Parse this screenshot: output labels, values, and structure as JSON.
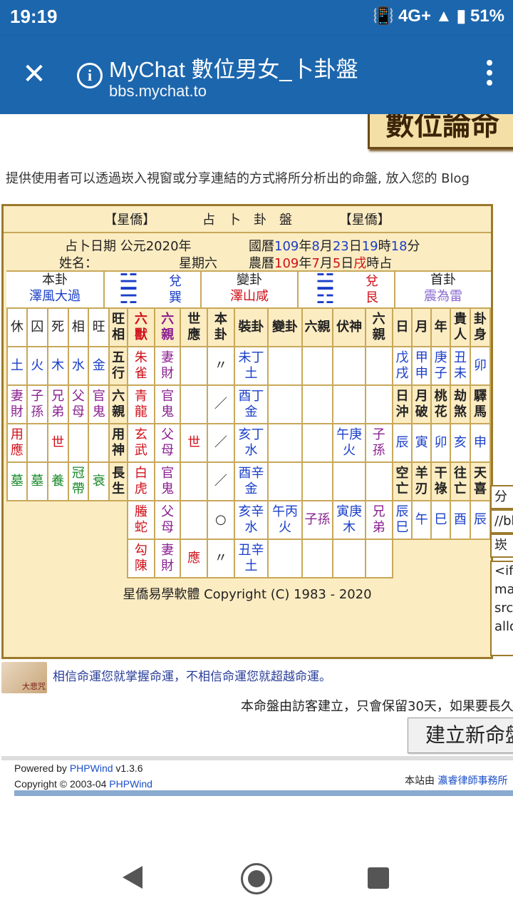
{
  "status": {
    "time": "19:19",
    "network": "4G+",
    "battery": "51%"
  },
  "appbar": {
    "title": "MyChat 數位男女_卜卦盤",
    "url": "bbs.mychat.to"
  },
  "banner": "數位論命",
  "intro": "提供使用者可以透過崁入視窗或分享連結的方式將所分析出的命盤, 放入您的 Blog",
  "board": {
    "title_left": "【星僑】",
    "title_mid": "占　卜　卦　盤",
    "title_right": "【星僑】",
    "date_label": "占卜日期 公元2020年",
    "greg_label": "國曆",
    "greg_y": "109",
    "greg_m": "8",
    "greg_d": "23",
    "greg_h": "19",
    "greg_min": "18",
    "nian": "年",
    "yue": "月",
    "ri": "日",
    "shi": "時",
    "fen": "分",
    "name_label": "姓名：",
    "weekday": "星期六",
    "lunar_label": "農曆",
    "lunar_y": "109",
    "lunar_m": "7",
    "lunar_d": "5",
    "lunar_h": "戌",
    "shizhan": "時占",
    "ben_label": "本卦",
    "ben_name": "澤風大過",
    "ben_up": "兌",
    "ben_down": "巽",
    "bian_label": "變卦",
    "bian_name": "澤山咸",
    "bian_up": "兌",
    "bian_down": "艮",
    "shou_label": "首卦",
    "shou_name": "震為雷",
    "headers": {
      "liushou": "六獸",
      "liuqin": "六親",
      "shiying": "世應",
      "bengua": "本卦",
      "zhuanggua": "裝卦",
      "biangua": "變卦",
      "liuqin2": "六親",
      "fushen": "伏神",
      "liuqin3": "六親",
      "wangxiang": "旺相",
      "wuxing": "五行",
      "liuqinL": "六親",
      "yongshen": "用神",
      "changsheng": "長生"
    },
    "left_seasons": [
      "休",
      "囚",
      "死",
      "相",
      "旺"
    ],
    "left_elements": [
      "土",
      "火",
      "木",
      "水",
      "金"
    ],
    "left_kin": [
      "妻財",
      "子孫",
      "兄弟",
      "父母",
      "官鬼"
    ],
    "left_yong": [
      "用應",
      "",
      "世",
      "",
      ""
    ],
    "left_chang": [
      "墓",
      "墓",
      "養",
      "冠帶",
      "衰"
    ],
    "rows": [
      {
        "beast": "朱雀",
        "kin": "妻財",
        "sy": "",
        "line": "〃",
        "zg": "未丁土",
        "bg": "",
        "bq": "",
        "fs": "",
        "fq": ""
      },
      {
        "beast": "青龍",
        "kin": "官鬼",
        "sy": "",
        "line": "／",
        "zg": "酉丁金",
        "bg": "",
        "bq": "",
        "fs": "",
        "fq": ""
      },
      {
        "beast": "玄武",
        "kin": "父母",
        "sy": "世",
        "line": "／",
        "zg": "亥丁水",
        "bg": "",
        "bq": "",
        "fs": "午庚火",
        "fq": "子孫"
      },
      {
        "beast": "白虎",
        "kin": "官鬼",
        "sy": "",
        "line": "／",
        "zg": "酉辛金",
        "bg": "",
        "bq": "",
        "fs": "",
        "fq": ""
      },
      {
        "beast": "螣蛇",
        "kin": "父母",
        "sy": "",
        "line": "○",
        "zg": "亥辛水",
        "bg": "午丙火",
        "bq": "子孫",
        "fs": "寅庚木",
        "fq": "兄弟"
      },
      {
        "beast": "勾陳",
        "kin": "妻財",
        "sy": "應",
        "line": "〃",
        "zg": "丑辛土",
        "bg": "",
        "bq": "",
        "fs": "",
        "fq": ""
      }
    ],
    "right_h1": [
      "日",
      "月",
      "年",
      "貴人",
      "卦身"
    ],
    "right_v1": [
      "戊戌",
      "甲申",
      "庚子",
      "丑未",
      "卯"
    ],
    "right_h2": [
      "日沖",
      "月破",
      "桃花",
      "劫煞",
      "驛馬"
    ],
    "right_v2": [
      "辰",
      "寅",
      "卯",
      "亥",
      "申"
    ],
    "right_h3": [
      "空亡",
      "羊刃",
      "干祿",
      "往亡",
      "天喜"
    ],
    "right_v3": [
      "辰巳",
      "午",
      "巳",
      "酉",
      "辰"
    ],
    "copyright": "星僑易學軟體 Copyright (C) 1983 - 2020"
  },
  "side": {
    "share": "分",
    "link": "//bb",
    "embed": "崁",
    "code": [
      "<ifr",
      "ma",
      "src",
      "allo"
    ]
  },
  "motto": {
    "img_text": "大悲咒",
    "text": "相信命運您就掌握命運，不相信命運您就超越命運。"
  },
  "notice": "本命盤由訪客建立，只會保留30天，如果要長久",
  "create_button": "建立新命盤",
  "footer": {
    "powered": "Powered by",
    "phpwind": "PHPWind",
    "ver": "v1.3.6",
    "copy": "Copyright © 2003-04",
    "phpwind2": "PHPWind",
    "siteby": "本站由",
    "lawyer": "瀛睿律師事務所"
  }
}
